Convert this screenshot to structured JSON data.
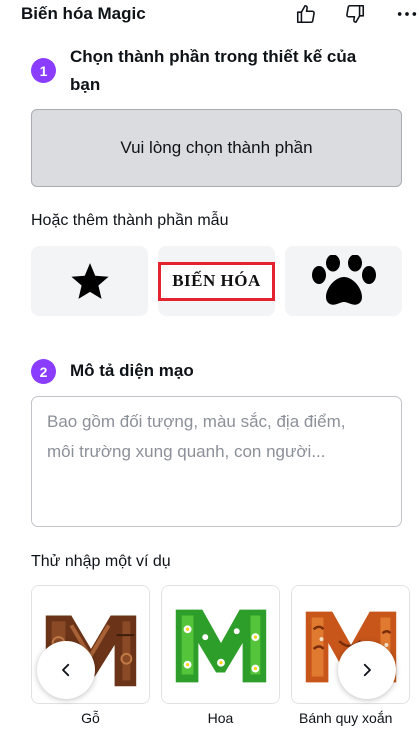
{
  "header": {
    "title": "Biến hóa Magic",
    "icons": [
      "thumbs-up-icon",
      "thumbs-down-icon",
      "more-icon"
    ]
  },
  "step1": {
    "number": "1",
    "title_line1": "Chọn thành phần trong thiết kế của",
    "title_line2": "bạn",
    "select_label": "Vui lòng chọn thành phần"
  },
  "samples": {
    "label": "Hoặc thêm thành phần mẫu",
    "items": [
      {
        "icon": "star-icon"
      },
      {
        "text": "BIẾN HÓA"
      },
      {
        "icon": "paw-icon"
      }
    ]
  },
  "step2": {
    "number": "2",
    "title": "Mô tả diện mạo",
    "placeholder_line1": "Bao gồm đối tượng, màu sắc, địa điểm,",
    "placeholder_line2": "môi trường xung quanh, con người..."
  },
  "examples": {
    "label": "Thử nhập một ví dụ",
    "items": [
      {
        "label": "Gỗ"
      },
      {
        "label": "Hoa"
      },
      {
        "label": "Bánh quy xoắn"
      }
    ],
    "prev_icon": "chevron-left-icon",
    "next_icon": "chevron-right-icon"
  },
  "colors": {
    "accent": "#8b3dff",
    "highlight_border": "#e3232d",
    "select_bg": "#dadce0"
  }
}
